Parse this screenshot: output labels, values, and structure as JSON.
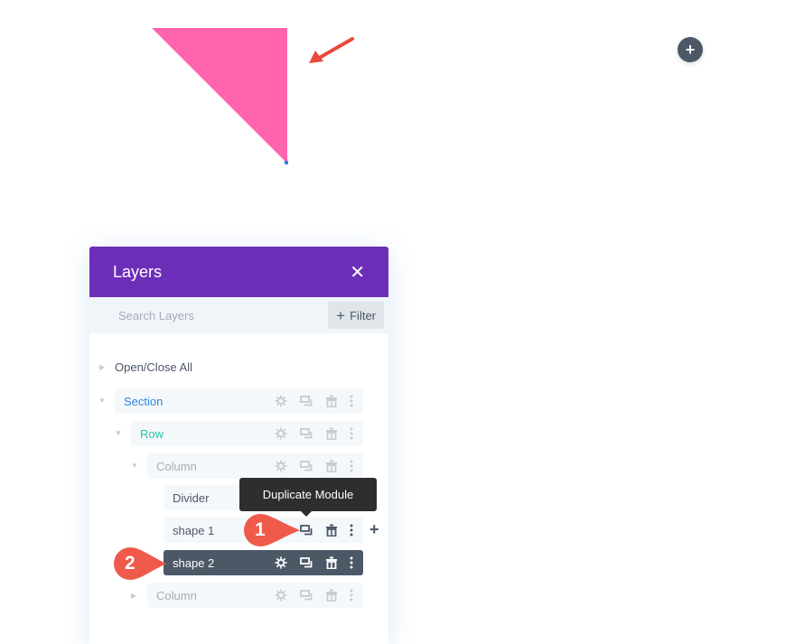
{
  "canvas": {
    "shape_color": "#ff64ad",
    "arrow_color": "#e8493a",
    "add_button_symbol": "+"
  },
  "layers_panel": {
    "title": "Layers",
    "close_symbol": "✕",
    "header_color": "#6c2eb9",
    "search_placeholder": "Search Layers",
    "filter_label": "Filter",
    "filter_symbol": "+",
    "open_close_all": "Open/Close All",
    "items": [
      {
        "label": "Section",
        "color": "#2b87da",
        "toggle": "▼"
      },
      {
        "label": "Row",
        "color": "#29c4a9",
        "toggle": "▼"
      },
      {
        "label": "Column",
        "color": "#a3abb6",
        "toggle": "▼"
      },
      {
        "label": "Divider",
        "color": "#4c5866"
      },
      {
        "label": "shape 1",
        "color": "#4c5866"
      },
      {
        "label": "shape 2",
        "color": "#ffffff",
        "selected": true
      },
      {
        "label": "Column",
        "color": "#a3abb6",
        "toggle": "▶"
      }
    ],
    "add_module_symbol": "+"
  },
  "tooltip": {
    "text": "Duplicate Module"
  },
  "callouts": [
    {
      "number": "1",
      "color": "#ef5a4a"
    },
    {
      "number": "2",
      "color": "#ef5a4a"
    }
  ]
}
